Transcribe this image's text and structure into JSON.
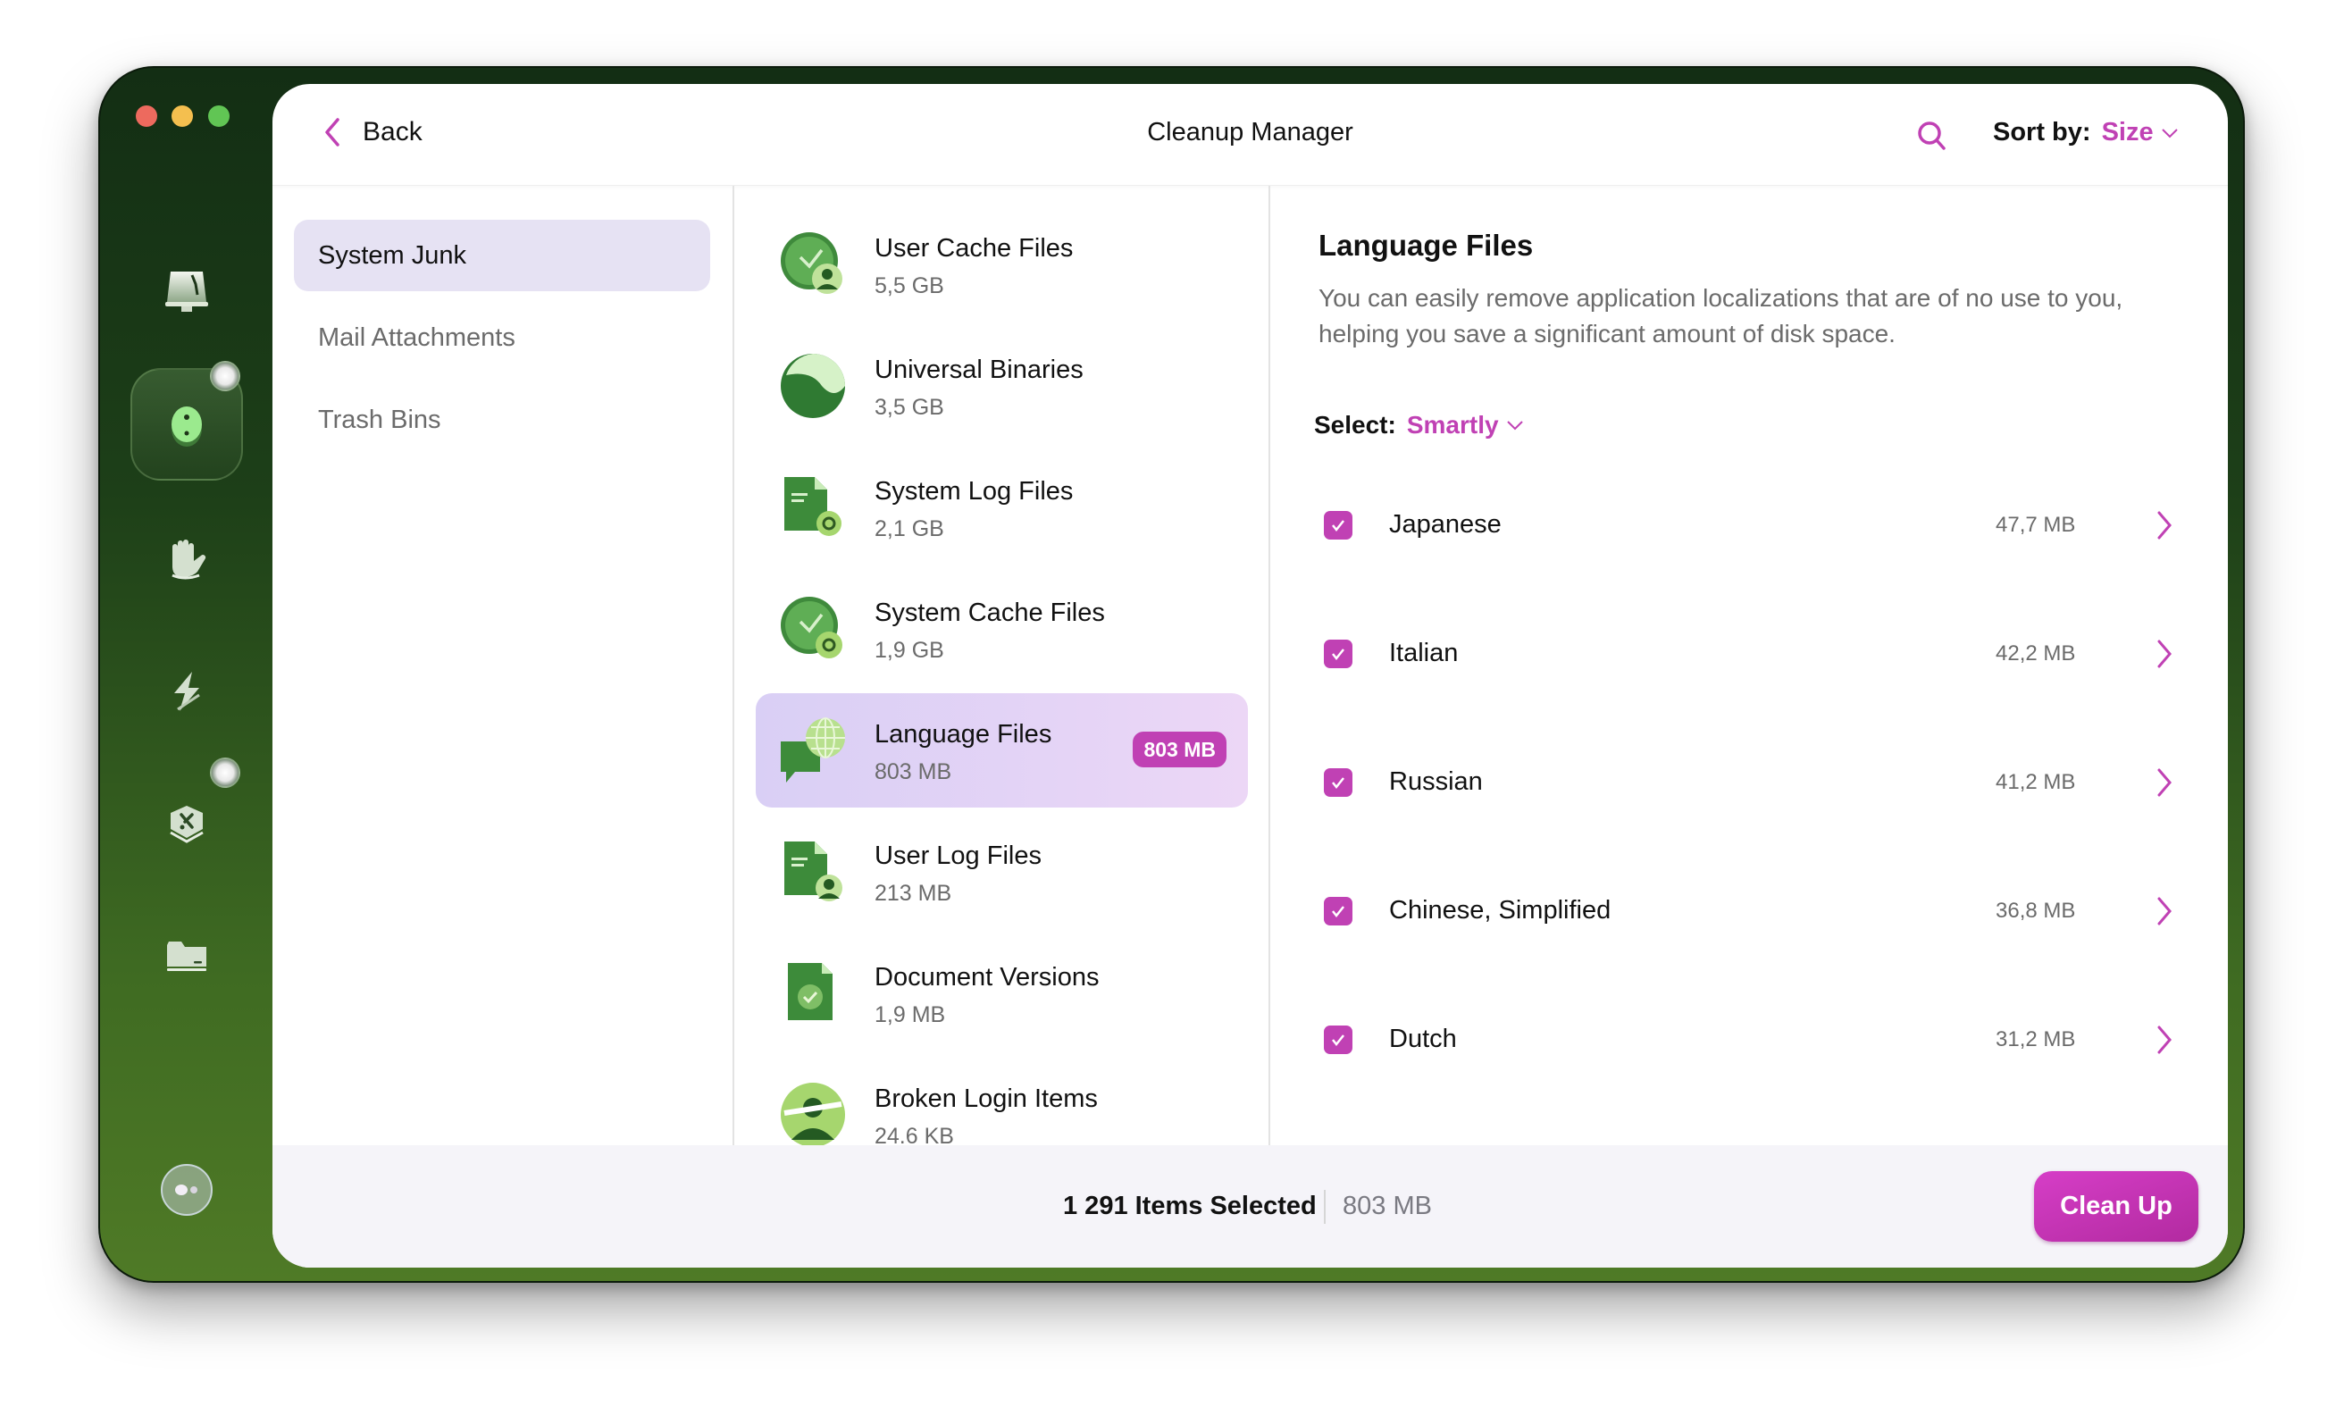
{
  "window": {
    "traffic_lights": [
      "close",
      "minimize",
      "zoom"
    ]
  },
  "rail": {
    "items": [
      {
        "name": "cleanup-icon"
      },
      {
        "name": "protection-icon",
        "active": true,
        "notification": true
      },
      {
        "name": "privacy-hand-icon"
      },
      {
        "name": "performance-bolt-icon"
      },
      {
        "name": "applications-icon",
        "notification": true
      },
      {
        "name": "files-folder-icon"
      },
      {
        "name": "assistant-icon"
      }
    ]
  },
  "header": {
    "back_label": "Back",
    "title": "Cleanup Manager",
    "sort_label": "Sort by:",
    "sort_value": "Size"
  },
  "nav": {
    "items": [
      {
        "label": "System Junk",
        "active": true
      },
      {
        "label": "Mail Attachments",
        "active": false
      },
      {
        "label": "Trash Bins",
        "active": false
      }
    ]
  },
  "categories": {
    "items": [
      {
        "name": "User Cache Files",
        "size": "5,5 GB",
        "icon": "user-cache-icon"
      },
      {
        "name": "Universal Binaries",
        "size": "3,5 GB",
        "icon": "universal-binaries-icon"
      },
      {
        "name": "System Log Files",
        "size": "2,1 GB",
        "icon": "system-log-icon"
      },
      {
        "name": "System Cache Files",
        "size": "1,9 GB",
        "icon": "system-cache-icon"
      },
      {
        "name": "Language Files",
        "size": "803 MB",
        "icon": "language-files-icon",
        "active": true,
        "badge": "803 MB"
      },
      {
        "name": "User Log Files",
        "size": "213 MB",
        "icon": "user-log-icon"
      },
      {
        "name": "Document Versions",
        "size": "1,9 MB",
        "icon": "document-versions-icon"
      },
      {
        "name": "Broken Login Items",
        "size": "24.6 KB",
        "icon": "broken-login-icon"
      }
    ]
  },
  "detail": {
    "title": "Language Files",
    "description": "You can easily remove application localizations that are of no use to you, helping you save a significant amount of disk space.",
    "select_label": "Select:",
    "select_value": "Smartly",
    "languages": [
      {
        "name": "Japanese",
        "size": "47,7 MB",
        "checked": true
      },
      {
        "name": "Italian",
        "size": "42,2 MB",
        "checked": true
      },
      {
        "name": "Russian",
        "size": "41,2 MB",
        "checked": true
      },
      {
        "name": "Chinese, Simplified",
        "size": "36,8 MB",
        "checked": true
      },
      {
        "name": "Dutch",
        "size": "31,2 MB",
        "checked": true
      }
    ]
  },
  "footer": {
    "items_selected": "1 291 Items Selected",
    "selected_size": "803 MB",
    "cleanup_label": "Clean Up"
  },
  "colors": {
    "accent": "#c041b4",
    "sidebar_top": "#132e14",
    "sidebar_bottom": "#4f7a26",
    "selection_bg": "#e6e2f3"
  }
}
